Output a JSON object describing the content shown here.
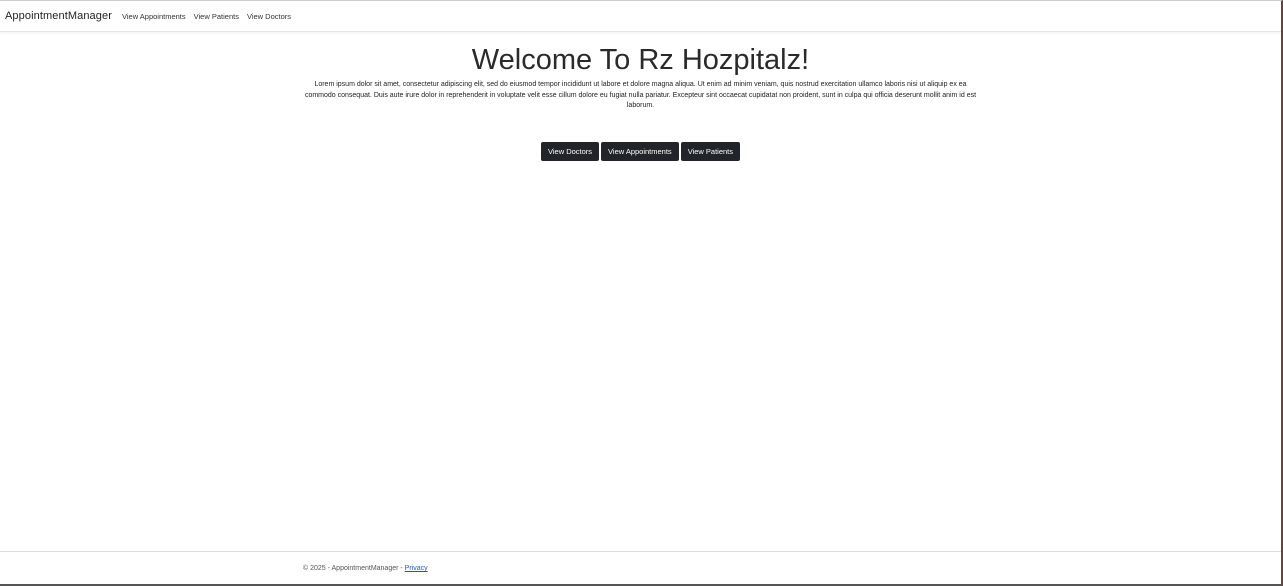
{
  "navbar": {
    "brand": "AppointmentManager",
    "links": [
      "View Appointments",
      "View Patients",
      "View Doctors"
    ]
  },
  "main": {
    "title": "Welcome To Rz Hozpitalz!",
    "lead": "Lorem ipsum dolor sit amet, consectetur adipiscing elit, sed do eiusmod tempor incididunt ut labore et dolore magna aliqua. Ut enim ad minim veniam, quis nostrud exercitation ullamco laboris nisi ut aliquip ex ea commodo consequat. Duis aute irure dolor in reprehenderit in voluptate velit esse cillum dolore eu fugiat nulla pariatur. Excepteur sint occaecat cupidatat non proident, sunt in culpa qui officia deserunt mollit anim id est laborum.",
    "buttons": [
      "View Doctors",
      "View Appointments",
      "View Patients"
    ]
  },
  "footer": {
    "copyright": "© 2025 - AppointmentManager - ",
    "privacy_link": "Privacy"
  },
  "colors": {
    "button_bg": "#212529",
    "link": "#1a57d6"
  }
}
